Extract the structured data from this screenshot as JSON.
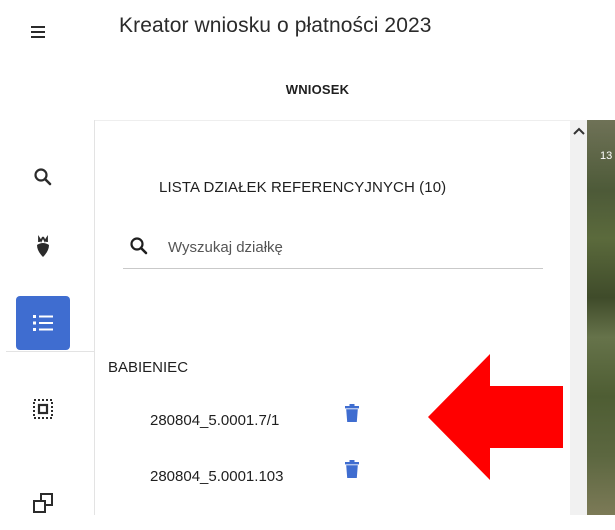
{
  "header": {
    "title": "Kreator wniosku o płatności 2023"
  },
  "tabs": [
    {
      "label": "WNIOSEK"
    }
  ],
  "toolbar": {
    "tools": [
      {
        "icon": "search-icon"
      },
      {
        "icon": "beet-icon"
      },
      {
        "icon": "list-icon",
        "active": true
      },
      {
        "icon": "select-area-icon"
      },
      {
        "icon": "copy-icon"
      }
    ]
  },
  "panel": {
    "title": "LISTA DZIAŁEK REFERENCYJNYCH (10)",
    "search": {
      "placeholder": "Wyszukaj działkę"
    },
    "group": {
      "name": "BABIENIEC",
      "parcels": [
        {
          "id": "280804_5.0001.7/1"
        },
        {
          "id": "280804_5.0001.103"
        }
      ]
    }
  },
  "map": {
    "edge_label": "13"
  },
  "colors": {
    "accent": "#3f6dd0",
    "trash": "#3f6dd0",
    "arrow": "#ff0000"
  }
}
